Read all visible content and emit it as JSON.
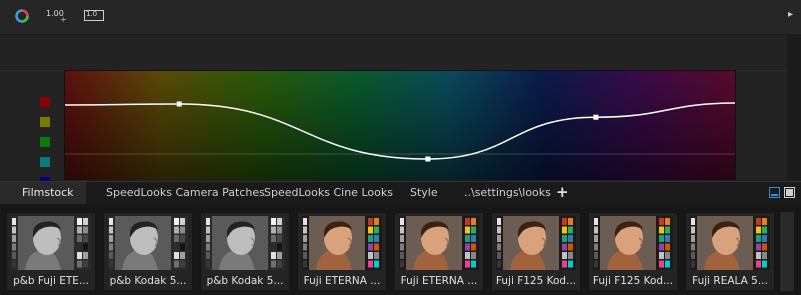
{
  "toolbar": {
    "icons": [
      "color-wheel-icon",
      "number-format-icon",
      "value-stepper-icon"
    ],
    "number_format_label": "1.00",
    "stepper_label": "1.0",
    "menu_arrow": "▸"
  },
  "curve_editor": {
    "swatch_colors": [
      "#8b0000",
      "#7a7a00",
      "#0b7a0b",
      "#0b7a7a",
      "#00008b"
    ],
    "gradient_colors": [
      "#5c0f0f",
      "#5a4a08",
      "#2a5a08",
      "#0a5a2a",
      "#0a4a5a",
      "#0a1a4a",
      "#3a0a4a",
      "#5a0a2a"
    ],
    "curve_points": [
      {
        "hue": 0.17,
        "value": 0.7
      },
      {
        "hue": 0.54,
        "value": 0.2
      },
      {
        "hue": 0.79,
        "value": 0.58
      }
    ],
    "curve_color": "#ffffff"
  },
  "tabs": {
    "items": [
      "Filmstock",
      "SpeedLooks Camera Patches",
      "SpeedLooks Cine Looks",
      "Style",
      "..\\settings\\looks"
    ],
    "active_index": 0,
    "add_symbol": "+"
  },
  "looks": [
    {
      "label": "p&b Fuji ETE...",
      "tone": "bw"
    },
    {
      "label": "p&b Kodak 5...",
      "tone": "bw"
    },
    {
      "label": "p&b Kodak 5...",
      "tone": "bw"
    },
    {
      "label": "Fuji ETERNA ...",
      "tone": "color"
    },
    {
      "label": "Fuji ETERNA ...",
      "tone": "color"
    },
    {
      "label": "Fuji F125 Kod...",
      "tone": "color"
    },
    {
      "label": "Fuji F125 Kod...",
      "tone": "color"
    },
    {
      "label": "Fuji REALA 5...",
      "tone": "color"
    }
  ],
  "colors": {
    "accent": "#2f8fd8",
    "panel": "#232323"
  }
}
